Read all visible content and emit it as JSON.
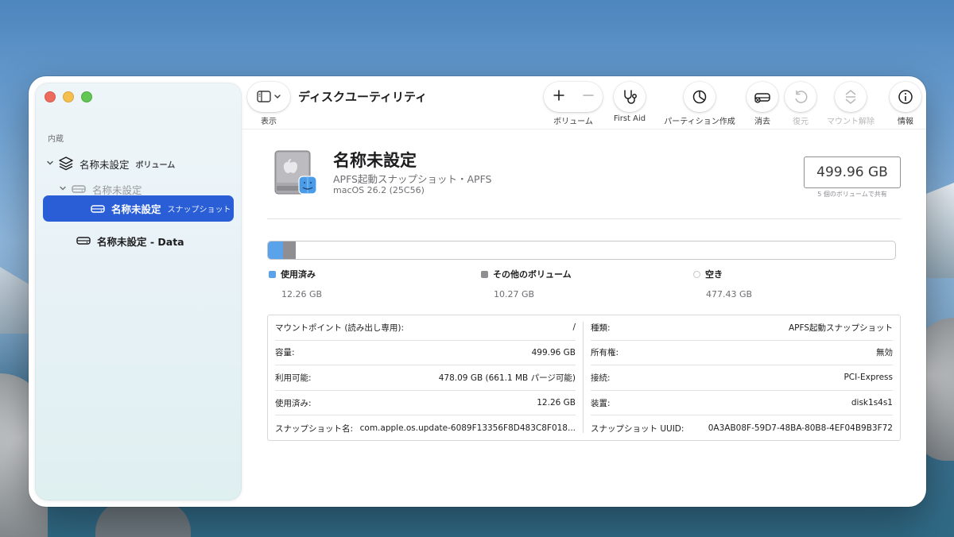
{
  "window": {
    "title": "ディスクユーティリティ"
  },
  "toolbar": {
    "view_label": "表示",
    "volume_label": "ボリューム",
    "firstaid_label": "First Aid",
    "partition_label": "パーティション作成",
    "erase_label": "消去",
    "restore_label": "復元",
    "unmount_label": "マウント解除",
    "info_label": "情報",
    "add_symbol": "+",
    "remove_symbol": "−"
  },
  "sidebar": {
    "section": "内蔵",
    "items": [
      {
        "name": "名称未設定",
        "sub": "ボリューム",
        "icon": "layers-icon"
      },
      {
        "name": "名称未設定",
        "sub": "",
        "icon": "drive-icon"
      },
      {
        "name": "名称未設定",
        "sub": "スナップショット",
        "icon": "drive-icon",
        "selected": true
      },
      {
        "name": "名称未設定 - Data",
        "sub": "",
        "icon": "drive-icon"
      }
    ]
  },
  "disk": {
    "name": "名称未設定",
    "subtitle": "APFS起動スナップショット・APFS",
    "version": "macOS 26.2 (25C56)",
    "capacity": "499.96 GB",
    "capacity_note": "5 個のボリュームで共有"
  },
  "usage": {
    "used_fraction": 0.0245,
    "other_fraction": 0.0205,
    "legend": [
      {
        "label": "使用済み",
        "value": "12.26 GB",
        "color": "#5aa3ea"
      },
      {
        "label": "その他のボリューム",
        "value": "10.27 GB",
        "color": "#8e8e93"
      },
      {
        "label": "空き",
        "value": "477.43 GB",
        "color": "#ffffff"
      }
    ]
  },
  "info_left": [
    {
      "key": "マウントポイント (読み出し専用):",
      "value": "/"
    },
    {
      "key": "容量:",
      "value": "499.96 GB"
    },
    {
      "key": "利用可能:",
      "value": "478.09 GB (661.1 MB パージ可能)"
    },
    {
      "key": "使用済み:",
      "value": "12.26 GB"
    },
    {
      "key": "スナップショット名:",
      "value": "com.apple.os.update-6089F13356F8D483C8F018..."
    }
  ],
  "info_right": [
    {
      "key": "種類:",
      "value": "APFS起動スナップショット"
    },
    {
      "key": "所有権:",
      "value": "無効"
    },
    {
      "key": "接続:",
      "value": "PCI-Express"
    },
    {
      "key": "装置:",
      "value": "disk1s4s1"
    },
    {
      "key": "スナップショット UUID:",
      "value": "0A3AB08F-59D7-48BA-80B8-4EF04B9B3F72"
    }
  ]
}
